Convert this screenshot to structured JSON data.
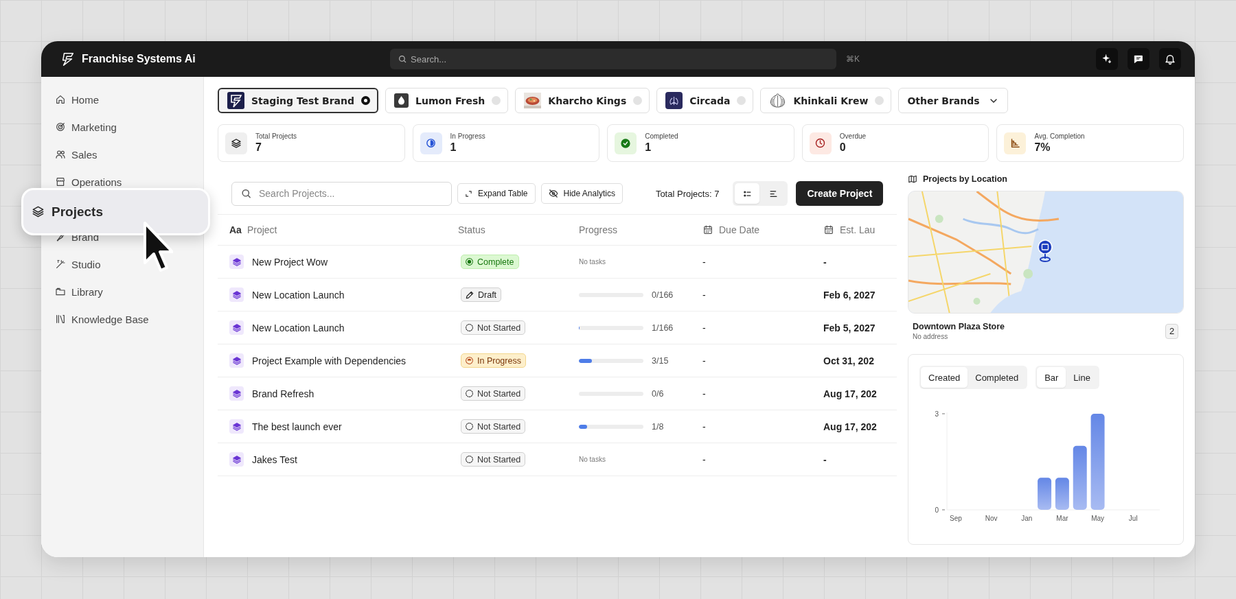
{
  "app": {
    "name": "Franchise Systems Ai"
  },
  "search": {
    "placeholder": "Search...",
    "shortcut": "⌘K"
  },
  "header_actions": [
    {
      "kind": "sparkle"
    },
    {
      "kind": "chat"
    },
    {
      "kind": "bell"
    }
  ],
  "sidebar": {
    "items": [
      {
        "kind": "home",
        "label": "Home",
        "selected": false
      },
      {
        "kind": "marketing",
        "label": "Marketing",
        "selected": false
      },
      {
        "kind": "sales",
        "label": "Sales",
        "selected": false
      },
      {
        "kind": "operations",
        "label": "Operations",
        "selected": false
      },
      {
        "kind": "projects",
        "label": "Projects",
        "selected": true
      },
      {
        "kind": "brand",
        "label": "Brand",
        "selected": false
      },
      {
        "kind": "studio",
        "label": "Studio",
        "selected": false
      },
      {
        "kind": "library",
        "label": "Library",
        "selected": false
      },
      {
        "kind": "knowledge",
        "label": "Knowledge Base",
        "selected": false
      }
    ]
  },
  "brands": [
    {
      "kind": "bolt",
      "name": "Staging Test Brand",
      "selected": true
    },
    {
      "kind": "drop",
      "name": "Lumon Fresh",
      "selected": false
    },
    {
      "name": "Kharcho Kings",
      "selected": false
    },
    {
      "kind": "bug",
      "name": "Circada",
      "selected": false
    },
    {
      "kind": "dumpling",
      "name": "Khinkali Krew",
      "selected": false
    }
  ],
  "other_brands": {
    "label": "Other Brands"
  },
  "stats": [
    {
      "kind": "total",
      "label": "Total Projects",
      "value": "7"
    },
    {
      "kind": "progress",
      "label": "In Progress",
      "value": "1"
    },
    {
      "kind": "completed",
      "label": "Completed",
      "value": "1"
    },
    {
      "kind": "overdue",
      "label": "Overdue",
      "value": "0"
    },
    {
      "kind": "average",
      "label": "Avg. Completion",
      "value": "7%"
    }
  ],
  "toolbar": {
    "search_placeholder": "Search Projects...",
    "buttons": [
      {
        "kind": "expand",
        "label": "Expand Table"
      },
      {
        "kind": "hide",
        "label": "Hide Analytics"
      }
    ],
    "total": "Total Projects: 7",
    "view_modes": [
      {
        "kind": "list",
        "selected": true
      },
      {
        "kind": "timeline",
        "selected": false
      }
    ],
    "create": "Create Project"
  },
  "table": {
    "columns": [
      {
        "kind": "title",
        "glyph": "Aa",
        "label": "Project"
      },
      {
        "kind": "plain",
        "label": "Status"
      },
      {
        "kind": "plain",
        "label": "Progress"
      },
      {
        "kind": "date",
        "label": "Due Date"
      },
      {
        "kind": "date",
        "label": "Est. Lau"
      }
    ],
    "rows": [
      {
        "name": "New Project Wow",
        "status": {
          "kind": "complete",
          "label": "Complete"
        },
        "progress": {
          "kind": "none",
          "text": "No tasks"
        },
        "due": "-",
        "launch": "-"
      },
      {
        "name": "New Location Launch",
        "status": {
          "kind": "draft",
          "label": "Draft"
        },
        "progress": {
          "kind": "bar",
          "level": 0,
          "reading": "0/166"
        },
        "due": "-",
        "launch": "Feb 6, 2027"
      },
      {
        "name": "New Location Launch",
        "status": {
          "kind": "not_started",
          "label": "Not Started"
        },
        "progress": {
          "kind": "bar",
          "level": 0.006,
          "reading": "1/166"
        },
        "due": "-",
        "launch": "Feb 5, 2027"
      },
      {
        "name": "Project Example with Dependencies",
        "status": {
          "kind": "in_progress",
          "label": "In Progress"
        },
        "progress": {
          "kind": "bar",
          "level": 0.2,
          "reading": "3/15"
        },
        "due": "-",
        "launch": "Oct 31, 202"
      },
      {
        "name": "Brand Refresh",
        "status": {
          "kind": "not_started",
          "label": "Not Started"
        },
        "progress": {
          "kind": "bar",
          "level": 0,
          "reading": "0/6"
        },
        "due": "-",
        "launch": "Aug 17, 202"
      },
      {
        "name": "The best launch ever",
        "status": {
          "kind": "not_started",
          "label": "Not Started"
        },
        "progress": {
          "kind": "bar",
          "level": 0.125,
          "reading": "1/8"
        },
        "due": "-",
        "launch": "Aug 17, 202"
      },
      {
        "name": "Jakes Test",
        "status": {
          "kind": "not_started",
          "label": "Not Started"
        },
        "progress": {
          "kind": "none",
          "text": "No tasks"
        },
        "due": "-",
        "launch": "-"
      }
    ]
  },
  "location_panel": {
    "title": "Projects by Location",
    "locations": [
      {
        "name": "Downtown Plaza Store",
        "address": "No address",
        "count": "2"
      }
    ]
  },
  "analytics": {
    "metric_tabs": [
      {
        "label": "Created",
        "selected": true
      },
      {
        "label": "Completed",
        "selected": false
      }
    ],
    "chart_types": [
      {
        "label": "Bar",
        "selected": true
      },
      {
        "label": "Line",
        "selected": false
      }
    ],
    "chart_data": {
      "type": "bar",
      "categories": [
        "Sep",
        null,
        "Nov",
        null,
        "Jan",
        null,
        "Mar",
        null,
        "May",
        null,
        "Jul",
        null
      ],
      "values": [
        0,
        0,
        0,
        0,
        0,
        1,
        1,
        2,
        3,
        0,
        0,
        0
      ],
      "yticks": [
        0,
        3
      ],
      "ylim": [
        0,
        3
      ]
    }
  }
}
